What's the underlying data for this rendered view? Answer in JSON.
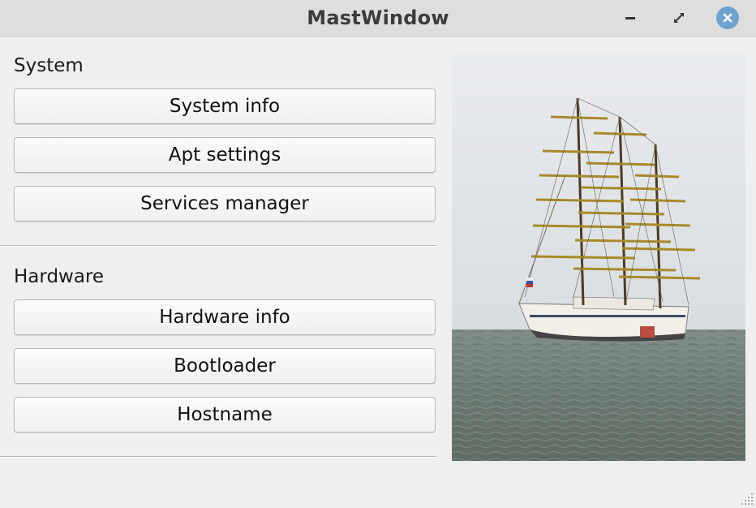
{
  "window": {
    "title": "MastWindow"
  },
  "titlebar_icons": [
    "minimize-icon",
    "maximize-icon",
    "close-icon"
  ],
  "sections": [
    {
      "label": "System",
      "buttons": [
        "System info",
        "Apt settings",
        "Services manager"
      ]
    },
    {
      "label": "Hardware",
      "buttons": [
        "Hardware info",
        "Bootloader",
        "Hostname"
      ]
    }
  ],
  "colors": {
    "titlebar": "#dedede",
    "close_button": "#6ea2cd",
    "window_bg": "#efefef"
  }
}
